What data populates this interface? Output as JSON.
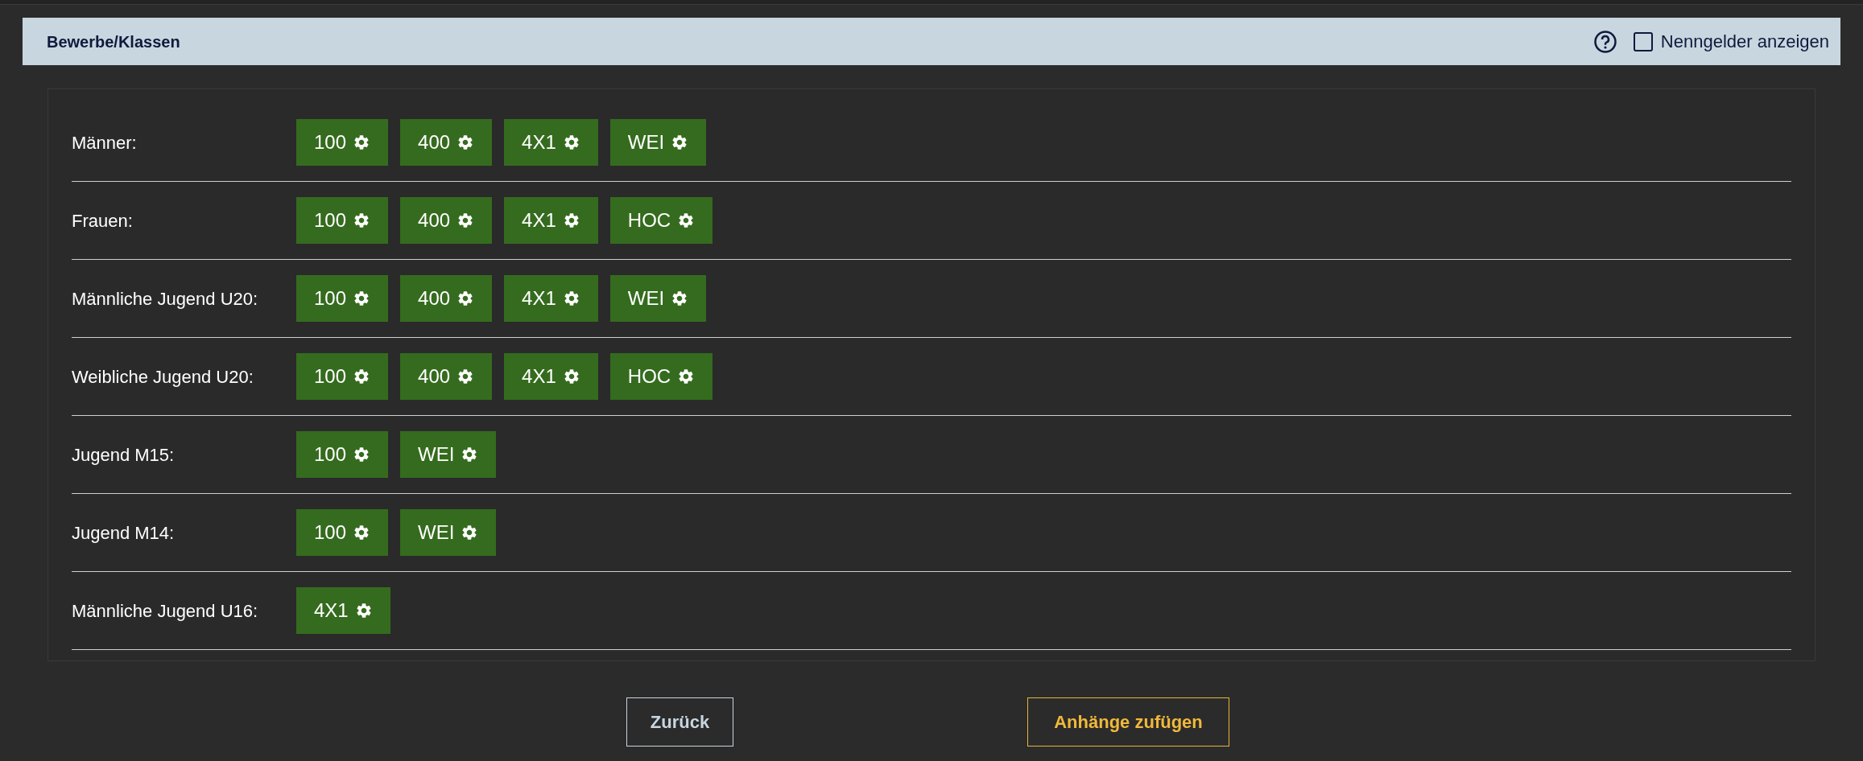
{
  "section": {
    "title": "Bewerbe/Klassen",
    "fee_toggle": {
      "label": "Nenngelder anzeigen",
      "checked": false
    }
  },
  "classes": [
    {
      "label": "Männer:",
      "events": [
        "100",
        "400",
        "4X1",
        "WEI"
      ]
    },
    {
      "label": "Frauen:",
      "events": [
        "100",
        "400",
        "4X1",
        "HOC"
      ]
    },
    {
      "label": "Männliche Jugend U20:",
      "events": [
        "100",
        "400",
        "4X1",
        "WEI"
      ]
    },
    {
      "label": "Weibliche Jugend U20:",
      "events": [
        "100",
        "400",
        "4X1",
        "HOC"
      ]
    },
    {
      "label": "Jugend M15:",
      "events": [
        "100",
        "WEI"
      ]
    },
    {
      "label": "Jugend M14:",
      "events": [
        "100",
        "WEI"
      ]
    },
    {
      "label": "Männliche Jugend U16:",
      "events": [
        "4X1"
      ]
    }
  ],
  "buttons": [
    {
      "kind": "secondary",
      "label": "Zurück"
    },
    {
      "kind": "primary",
      "label": "Anhänge zufügen"
    }
  ]
}
